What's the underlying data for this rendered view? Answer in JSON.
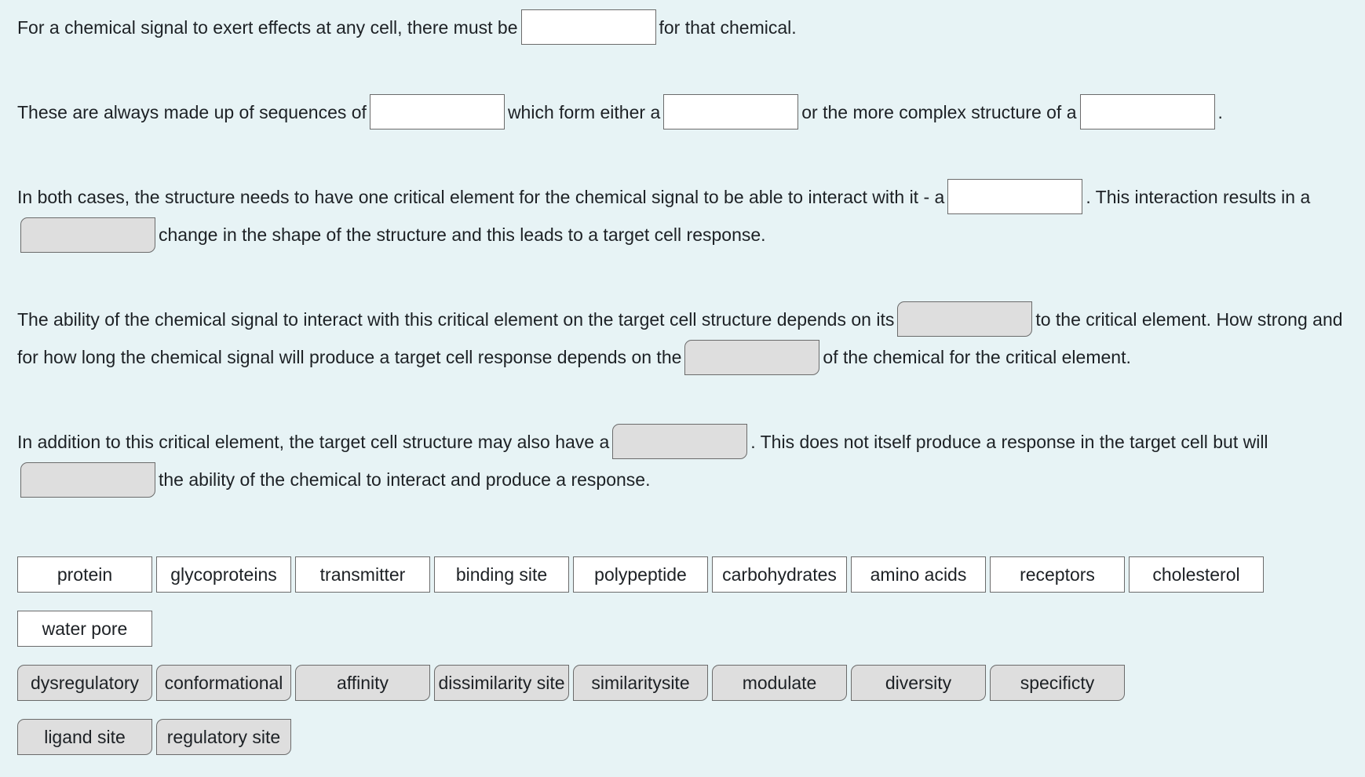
{
  "paragraphs": {
    "p1": {
      "t1": "For a chemical signal to exert effects at any cell, there must be",
      "t2": "for that chemical."
    },
    "p2": {
      "t1": "These are always made up of sequences of",
      "t2": "which form either a",
      "t3": "or the more complex structure of a",
      "t4": "."
    },
    "p3": {
      "t1": "In both cases, the structure needs to have one critical element for the chemical signal to be able to interact with it - a",
      "t2": ". This interaction results in a",
      "t3": "change in the shape of the structure and this leads to a target cell response."
    },
    "p4": {
      "t1": "The ability of the chemical signal to interact with this critical element on the target cell structure depends on its",
      "t2": "to the critical element. How strong and for how long the chemical signal will produce a target cell response depends on the",
      "t3": "of the chemical for the critical element."
    },
    "p5": {
      "t1": "In addition to this critical element, the target cell structure may also have a",
      "t2": ". This does not itself produce a response in the target cell but will",
      "t3": "the ability of the chemical to interact and produce a response."
    }
  },
  "word_bank": {
    "group1": [
      "protein",
      "glycoproteins",
      "transmitter",
      "binding site",
      "polypeptide",
      "carbohydrates",
      "amino acids",
      "receptors",
      "cholesterol",
      "water pore"
    ],
    "group2": [
      "dysregulatory",
      "conformational",
      "affinity",
      "dissimilarity site",
      "similaritysite",
      "modulate",
      "diversity",
      "specificty",
      "ligand site",
      "regulatory site"
    ]
  },
  "colors": {
    "page_background": "#e7f3f5",
    "group1_fill": "#ffffff",
    "group2_fill": "#dedede",
    "border": "#6b6b6b",
    "text": "#1d2125"
  }
}
